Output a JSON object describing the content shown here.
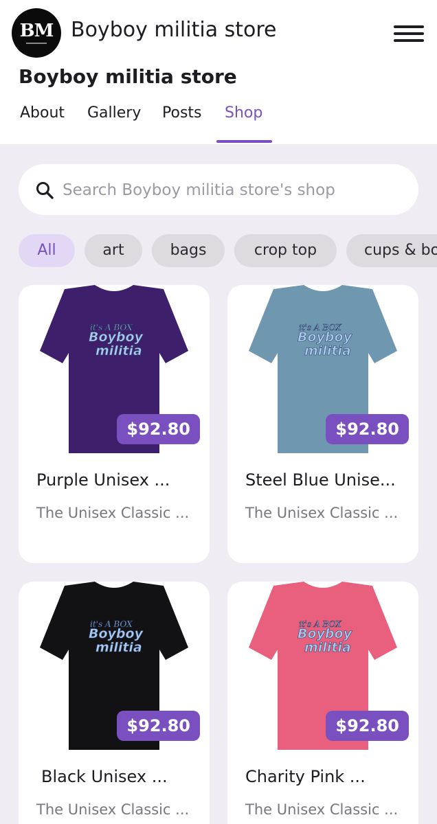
{
  "header": {
    "logo_text": "BM",
    "brand_name": "Boyboy militia store",
    "menu_icon": "hamburger-menu-icon"
  },
  "page_title": "Boyboy militia store",
  "tabs": [
    {
      "label": "About"
    },
    {
      "label": "Gallery"
    },
    {
      "label": "Posts"
    },
    {
      "label": "Shop",
      "active": true
    }
  ],
  "search": {
    "placeholder": "Search Boyboy militia store's shop",
    "value": "",
    "icon": "search-icon"
  },
  "chips": [
    {
      "label": "All",
      "active": true
    },
    {
      "label": "art"
    },
    {
      "label": "bags"
    },
    {
      "label": "crop top"
    },
    {
      "label": "cups & bo"
    }
  ],
  "products": [
    {
      "title": "Purple Unisex ...",
      "subtitle": "The Unisex Classic ...",
      "price": "$92.80",
      "shirt_color": "#3d1f6c",
      "print_top": "it's A BOX",
      "print_main": "Boyboy",
      "print_bottom": "militia"
    },
    {
      "title": "Steel Blue Unise...",
      "subtitle": "The Unisex Classic ...",
      "price": "$92.80",
      "shirt_color": "#6f98b0",
      "print_top": "it's A BOX",
      "print_main": "Boyboy",
      "print_bottom": "militia"
    },
    {
      "title": "Black Unisex ...",
      "subtitle": "The Unisex Classic ...",
      "price": "$92.80",
      "shirt_color": "#121214",
      "print_top": "it's A BOX",
      "print_main": "Boyboy",
      "print_bottom": "militia"
    },
    {
      "title": "Charity Pink ...",
      "subtitle": "The Unisex Classic ...",
      "price": "$92.80",
      "shirt_color": "#e9607f",
      "print_top": "it's A BOX",
      "print_main": "Boyboy",
      "print_bottom": "militia"
    }
  ],
  "colors": {
    "accent": "#7a4fc0",
    "chip_active_bg": "#e2d8f6",
    "chip_bg": "#dedbe0",
    "page_bg": "#efedf3",
    "print_color": "#a9c9ee"
  }
}
